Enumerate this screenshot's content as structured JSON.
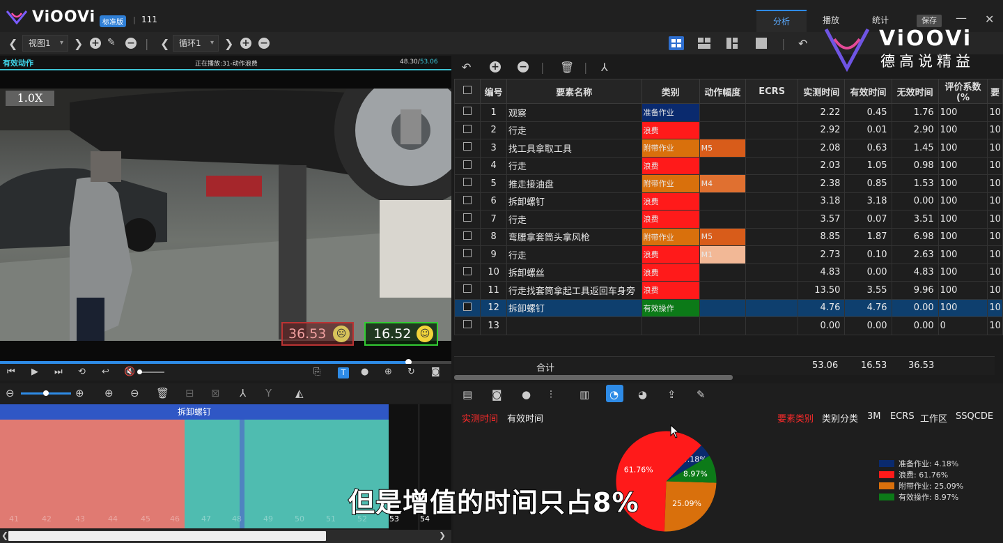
{
  "app": {
    "name": "ViOOVi",
    "edition": "标准版",
    "separator": "|",
    "project": "111"
  },
  "tabs": [
    {
      "label": "分析",
      "active": true
    },
    {
      "label": "播放"
    },
    {
      "label": "统计"
    }
  ],
  "window": {
    "save_label": "保存",
    "minimize": "—",
    "close": "✕"
  },
  "toolbar": {
    "view_select": "视图1",
    "loop_select": "循环1"
  },
  "video": {
    "label": "有效动作",
    "now_playing": "正在播放:31-动作浪费",
    "time_current": "48.30/",
    "time_total": "53.06",
    "speed": "1.0X",
    "invalid_time": "36.53",
    "valid_time": "16.52",
    "progress_fraction": 0.905
  },
  "timeline": {
    "segment_title": "拆卸螺钉",
    "ticks_dim": [
      "41",
      "42",
      "43",
      "44",
      "45",
      "46"
    ],
    "ticks": [
      "47",
      "48",
      "49",
      "50",
      "51",
      "52",
      "53",
      "54"
    ]
  },
  "table": {
    "headers": [
      "编号",
      "要素名称",
      "类别",
      "动作幅度",
      "ECRS",
      "实测时间",
      "有效时间",
      "无效时间",
      "评价系数(%",
      "要"
    ],
    "rows": [
      {
        "no": "1",
        "name": "观察",
        "cat": "准备作业",
        "amp": "",
        "measured": "2.22",
        "valid": "0.45",
        "invalid": "1.76",
        "rate": "100",
        "extra": "10"
      },
      {
        "no": "2",
        "name": "行走",
        "cat": "浪费",
        "amp": "",
        "measured": "2.92",
        "valid": "0.01",
        "invalid": "2.90",
        "rate": "100",
        "extra": "10"
      },
      {
        "no": "3",
        "name": "找工具拿取工具",
        "cat": "附带作业",
        "amp": "M5",
        "measured": "2.08",
        "valid": "0.63",
        "invalid": "1.45",
        "rate": "100",
        "extra": "10"
      },
      {
        "no": "4",
        "name": "行走",
        "cat": "浪费",
        "amp": "",
        "measured": "2.03",
        "valid": "1.05",
        "invalid": "0.98",
        "rate": "100",
        "extra": "10"
      },
      {
        "no": "5",
        "name": "推走接油盘",
        "cat": "附带作业",
        "amp": "M4",
        "measured": "2.38",
        "valid": "0.85",
        "invalid": "1.53",
        "rate": "100",
        "extra": "10"
      },
      {
        "no": "6",
        "name": "拆卸螺钉",
        "cat": "浪费",
        "amp": "",
        "measured": "3.18",
        "valid": "3.18",
        "invalid": "0.00",
        "rate": "100",
        "extra": "10"
      },
      {
        "no": "7",
        "name": "行走",
        "cat": "浪费",
        "amp": "",
        "measured": "3.57",
        "valid": "0.07",
        "invalid": "3.51",
        "rate": "100",
        "extra": "10"
      },
      {
        "no": "8",
        "name": "弯腰拿套筒头拿风枪",
        "cat": "附带作业",
        "amp": "M5",
        "measured": "8.85",
        "valid": "1.87",
        "invalid": "6.98",
        "rate": "100",
        "extra": "10"
      },
      {
        "no": "9",
        "name": "行走",
        "cat": "浪费",
        "amp": "M1",
        "measured": "2.73",
        "valid": "0.10",
        "invalid": "2.63",
        "rate": "100",
        "extra": "10"
      },
      {
        "no": "10",
        "name": "拆卸螺丝",
        "cat": "浪费",
        "amp": "",
        "measured": "4.83",
        "valid": "0.00",
        "invalid": "4.83",
        "rate": "100",
        "extra": "10"
      },
      {
        "no": "11",
        "name": "行走找套筒拿起工具返回车身旁",
        "cat": "浪费",
        "amp": "",
        "measured": "13.50",
        "valid": "3.55",
        "invalid": "9.96",
        "rate": "100",
        "extra": "10"
      },
      {
        "no": "12",
        "name": "拆卸螺钉",
        "cat": "有效操作",
        "amp": "",
        "measured": "4.76",
        "valid": "4.76",
        "invalid": "0.00",
        "rate": "100",
        "extra": "10"
      },
      {
        "no": "13",
        "name": "",
        "cat": "",
        "amp": "",
        "measured": "0.00",
        "valid": "0.00",
        "invalid": "0.00",
        "rate": "0",
        "extra": "10"
      }
    ],
    "total": {
      "label": "合计",
      "measured": "53.06",
      "valid": "16.53",
      "invalid": "36.53"
    },
    "selected_row": 12
  },
  "colors": {
    "准备作业": "#0a2a6e",
    "浪费": "#ff1a1a",
    "附带作业": "#d9700c",
    "有效操作": "#0c7a18",
    "M5": "#d85c1a",
    "M4": "#e07030",
    "M1": "#f2b896"
  },
  "chart_panel": {
    "left_options": [
      {
        "label": "实测时间",
        "active": true
      },
      {
        "label": "有效时间"
      }
    ],
    "right_options": [
      {
        "label": "要素类别",
        "active": true
      },
      {
        "label": "类别分类"
      },
      {
        "label": "3M"
      },
      {
        "label": "ECRS"
      },
      {
        "label": "工作区"
      },
      {
        "label": "SSQCDE"
      }
    ]
  },
  "chart_data": {
    "type": "pie",
    "slices": [
      {
        "name": "准备作业",
        "value": 4.18,
        "color": "#0a2a6e",
        "label": "4.18%"
      },
      {
        "name": "浪费",
        "value": 61.76,
        "color": "#ff1a1a",
        "label": "61.76%"
      },
      {
        "name": "附带作业",
        "value": 25.09,
        "color": "#d9700c",
        "label": "25.09%"
      },
      {
        "name": "有效操作",
        "value": 8.97,
        "color": "#0c7a18",
        "label": "8.97%"
      }
    ],
    "legend": [
      "准备作业: 4.18%",
      "浪费: 61.76%",
      "附带作业: 25.09%",
      "有效操作: 8.97%"
    ],
    "legend_position": "right"
  },
  "subtitle": "但是增值的时间只占8%",
  "watermark": {
    "brand": "ViOOVi",
    "slogan": "德高说精益"
  }
}
